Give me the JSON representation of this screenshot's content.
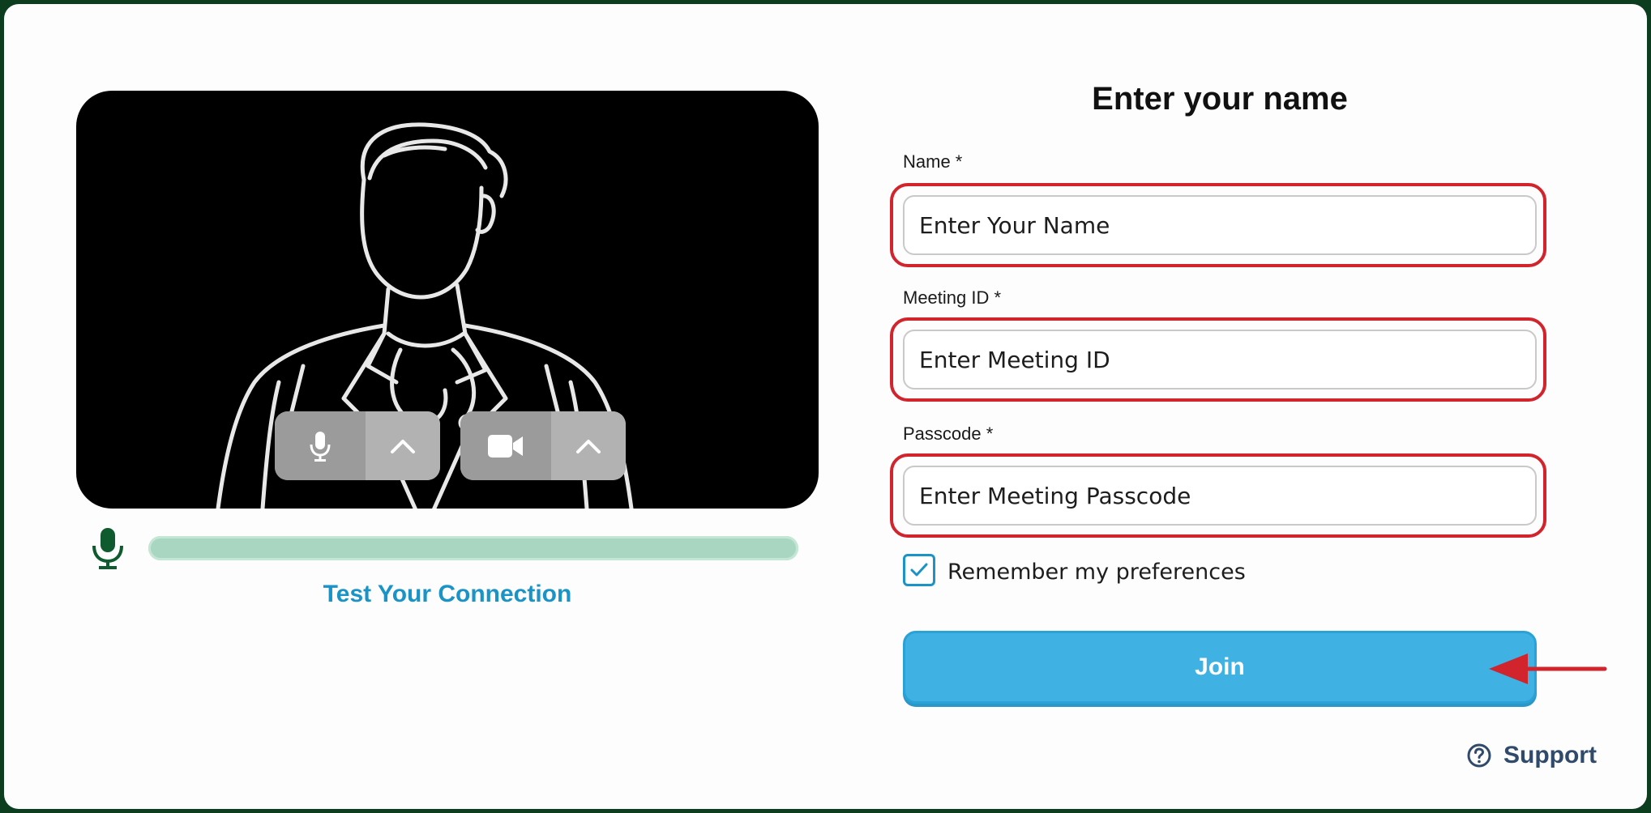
{
  "form": {
    "title": "Enter your name",
    "name_label": "Name *",
    "name_placeholder": "Enter Your Name",
    "meeting_id_label": "Meeting ID *",
    "meeting_id_placeholder": "Enter Meeting ID",
    "passcode_label": "Passcode *",
    "passcode_placeholder": "Enter Meeting Passcode",
    "remember_label": "Remember my preferences",
    "remember_checked": true,
    "join_label": "Join"
  },
  "preview": {
    "mic_icon": "microphone-icon",
    "camera_icon": "video-camera-icon",
    "caret_icon": "chevron-up-icon",
    "mic_level_icon": "microphone-icon",
    "test_connection_label": "Test Your Connection"
  },
  "support": {
    "label": "Support",
    "icon": "question-circle-icon"
  },
  "colors": {
    "accent": "#3fb1e3",
    "link": "#1a93c6",
    "highlight": "#d1242d",
    "mic_green": "#0f5a2e",
    "level_bar": "#a9d6c0",
    "frame_border": "#0b3d1e"
  }
}
